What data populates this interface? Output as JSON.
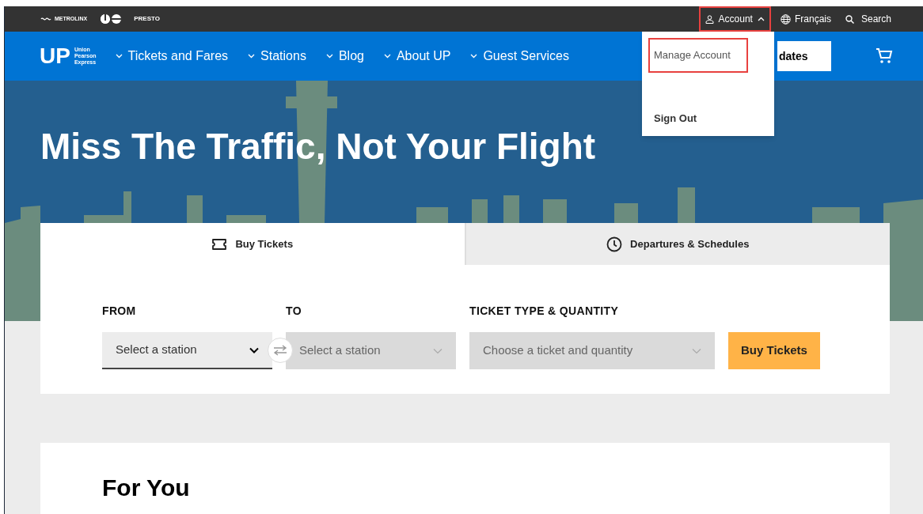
{
  "top_bar": {
    "brands": [
      "METROLINX",
      "PRESTO"
    ],
    "account": {
      "label": "Account",
      "expanded": true,
      "highlighted": true
    },
    "language": "Français",
    "search": "Search"
  },
  "nav": {
    "logo": {
      "mark": "UP",
      "lines": [
        "Union",
        "Pearson",
        "Express"
      ]
    },
    "items": [
      "Tickets and Fares",
      "Stations",
      "Blog",
      "About UP",
      "Guest Services"
    ],
    "updates_button": "dates"
  },
  "account_menu": [
    {
      "label": "Manage Account",
      "highlighted": true
    },
    {
      "label": "Sign Out",
      "highlighted": false
    }
  ],
  "hero": {
    "title": "Miss The Traffic, Not Your Flight"
  },
  "tabs": [
    {
      "label": "Buy Tickets",
      "selected": true
    },
    {
      "label": "Departures & Schedules",
      "selected": false
    }
  ],
  "form": {
    "fields": [
      {
        "label": "FROM",
        "placeholder": "Select a station",
        "disabled": false
      },
      {
        "label": "TO",
        "placeholder": "Select a station",
        "disabled": true
      },
      {
        "label": "TICKET TYPE & QUANTITY",
        "placeholder": "Choose a ticket and quantity",
        "disabled": true
      }
    ],
    "submit": "Buy Tickets"
  },
  "section": {
    "title": "For You"
  }
}
